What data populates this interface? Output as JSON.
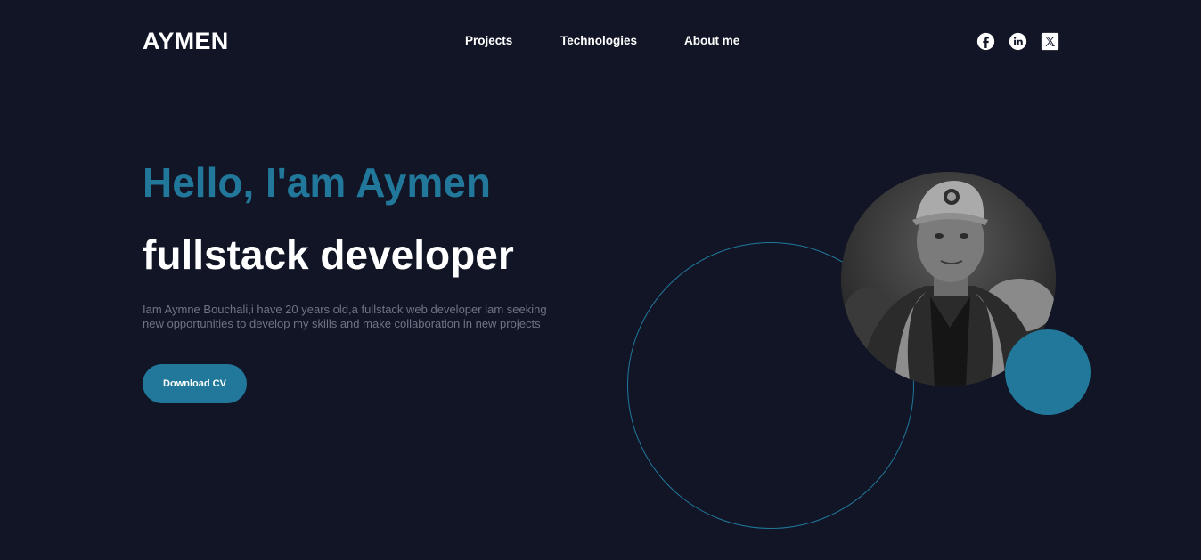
{
  "header": {
    "logo": "AYMEN",
    "nav": [
      "Projects",
      "Technologies",
      "About me"
    ],
    "social_icons": [
      "facebook-icon",
      "linkedin-icon",
      "x-icon"
    ]
  },
  "hero": {
    "greeting": "Hello, I'am Aymen",
    "role": "fullstack developer",
    "description": "Iam Aymne Bouchali,i have 20 years old,a fullstack web developer iam seeking new opportunities to develop my skills and make collaboration in new projects",
    "cta_label": "Download CV"
  },
  "colors": {
    "background": "#111526",
    "accent": "#21789b",
    "text": "#ffffff",
    "muted": "#6f7385"
  }
}
